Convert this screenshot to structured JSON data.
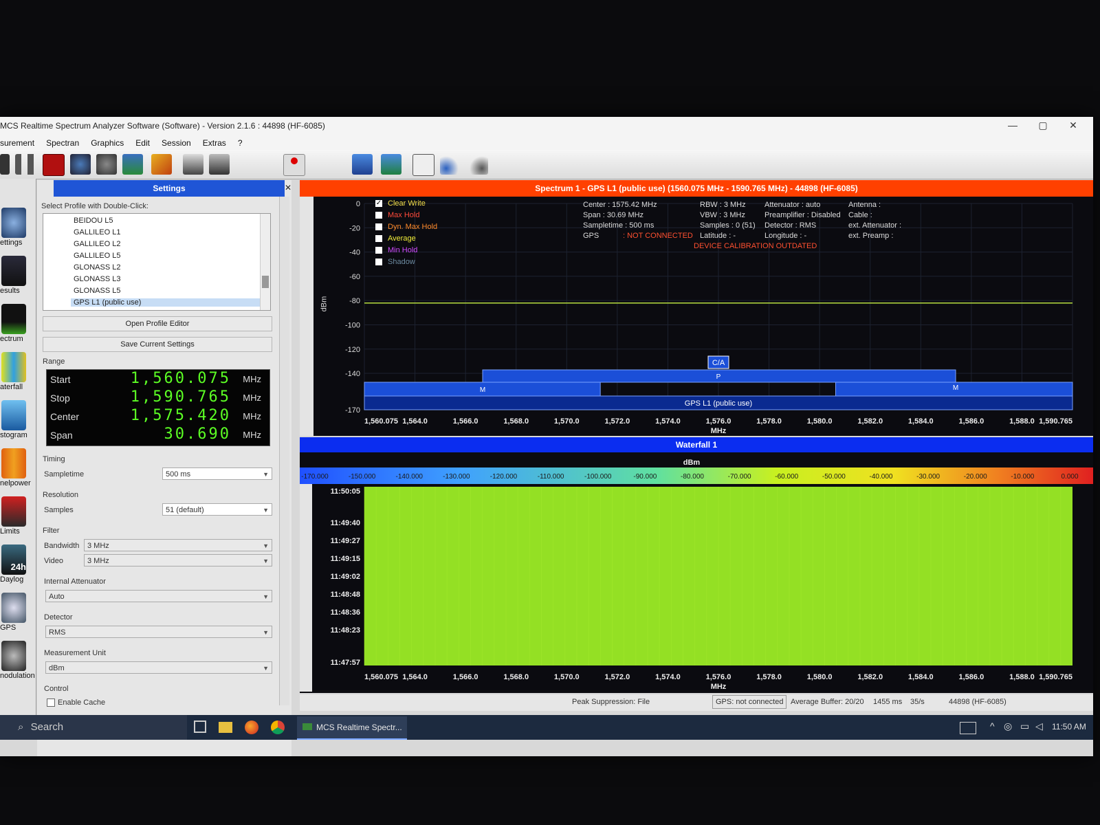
{
  "window": {
    "title": "MCS Realtime Spectrum Analyzer Software (Software) - Version 2.1.6 : 44898 (HF-6085)",
    "minimize": "—",
    "maximize": "▢",
    "close": "✕"
  },
  "menu": [
    "surement",
    "Spectran",
    "Graphics",
    "Edit",
    "Session",
    "Extras",
    "?"
  ],
  "iconbar": [
    "ettings",
    "esults",
    "ectrum",
    "aterfall",
    "stogram",
    "nelpower",
    "Limits",
    "Daylog",
    "GPS",
    "nodulation"
  ],
  "iconbar_overlay": "24h",
  "settings": {
    "header": "Settings",
    "profile_prompt": "Select Profile with Double-Click:",
    "profiles": [
      "BEIDOU L5",
      "GALLILEO L1",
      "GALLILEO L2",
      "GALLILEO L5",
      "GLONASS L2",
      "GLONASS L3",
      "GLONASS L5",
      "GPS L1 (public use)"
    ],
    "open_editor": "Open Profile Editor",
    "save_settings": "Save Current Settings",
    "range_label": "Range",
    "range": [
      {
        "name": "Start",
        "value": "1,560.075",
        "unit": "MHz"
      },
      {
        "name": "Stop",
        "value": "1,590.765",
        "unit": "MHz"
      },
      {
        "name": "Center",
        "value": "1,575.420",
        "unit": "MHz"
      },
      {
        "name": "Span",
        "value": "30.690",
        "unit": "MHz"
      }
    ],
    "timing_label": "Timing",
    "sampletime_label": "Sampletime",
    "sampletime_value": "500 ms",
    "resolution_label": "Resolution",
    "samples_label": "Samples",
    "samples_value": "51 (default)",
    "filter_label": "Filter",
    "bandwidth_label": "Bandwidth",
    "bandwidth_value": "3 MHz",
    "video_label": "Video",
    "video_value": "3 MHz",
    "attenuator_label": "Internal Attenuator",
    "attenuator_value": "Auto",
    "detector_label": "Detector",
    "detector_value": "RMS",
    "unit_label": "Measurement Unit",
    "unit_value": "dBm",
    "control_label": "Control",
    "enable_cache": "Enable Cache"
  },
  "spectrum": {
    "header": "Spectrum 1 - GPS L1 (public use) (1560.075 MHz - 1590.765 MHz) - 44898 (HF-6085)",
    "traces": [
      {
        "name": "Clear Write",
        "checked": true,
        "color": "#f5e04b"
      },
      {
        "name": "Max Hold",
        "checked": false,
        "color": "#ff4a3a"
      },
      {
        "name": "Dyn. Max Hold",
        "checked": false,
        "color": "#ff8a2a"
      },
      {
        "name": "Average",
        "checked": false,
        "color": "#f2ee3a"
      },
      {
        "name": "Min Hold",
        "checked": false,
        "color": "#d04bff"
      },
      {
        "name": "Shadow",
        "checked": false,
        "color": "#6c8aa0"
      }
    ],
    "info": {
      "center": "Center        : 1575.42 MHz",
      "span": "Span          : 30.69 MHz",
      "sampletime": "Sampletime : 500 ms",
      "gps_key": "GPS",
      "gps_val": ": NOT CONNECTED",
      "rbw": "RBW    : 3 MHz",
      "vbw": "VBW    : 3 MHz",
      "samples": "Samples : 0 (51)",
      "latitude": "Latitude : -",
      "att": "Attenuator : auto",
      "preamp": "Preamplifier : Disabled",
      "detector": "Detector    : RMS",
      "longitude": "Longitude   : -",
      "antenna": "Antenna         :",
      "cable": "Cable             :",
      "ext_att": "ext. Attenuator :",
      "ext_pre": "ext. Preamp      :",
      "warning": "DEVICE CALIBRATION OUTDATED"
    },
    "y_unit": "dBm",
    "x_unit": "MHz",
    "y_ticks": [
      "0",
      "-20",
      "-40",
      "-60",
      "-80",
      "-100",
      "-120",
      "-140",
      "-170"
    ],
    "x_ticks": [
      "1,560.075",
      "1,564.0",
      "1,566.0",
      "1,568.0",
      "1,570.0",
      "1,572.0",
      "1,574.0",
      "1,576.0",
      "1,578.0",
      "1,580.0",
      "1,582.0",
      "1,584.0",
      "1,586.0",
      "1,588.0",
      "1,590.765"
    ],
    "bands": {
      "ca": "C/A",
      "p": "P",
      "m1": "M",
      "m2": "M",
      "gps": "GPS L1 (public use)"
    }
  },
  "chart_data": {
    "type": "line",
    "x": [
      1560.075,
      1565,
      1570,
      1575,
      1580,
      1585,
      1590.765
    ],
    "series": [
      {
        "name": "Clear Write",
        "values": [
          -82,
          -82,
          -82,
          -82,
          -82,
          -82,
          -82
        ]
      }
    ],
    "ylabel": "dBm",
    "xlabel": "MHz",
    "xlim": [
      1560.075,
      1590.765
    ],
    "ylim": [
      -170,
      0
    ]
  },
  "waterfall": {
    "header": "Waterfall 1",
    "scale_unit": "dBm",
    "scale": [
      "-170.000",
      "-150.000",
      "-140.000",
      "-130.000",
      "-120.000",
      "-110.000",
      "-100.000",
      "-90.000",
      "-80.000",
      "-70.000",
      "-60.000",
      "-50.000",
      "-40.000",
      "-30.000",
      "-20.000",
      "-10.000",
      "0.000"
    ],
    "times": [
      "11:50:05",
      "11:49:40",
      "11:49:27",
      "11:49:15",
      "11:49:02",
      "11:48:48",
      "11:48:36",
      "11:48:23",
      "11:47:57"
    ],
    "x_unit": "MHz"
  },
  "status": {
    "peak": "Peak Suppression: File",
    "gps": "GPS: not connected",
    "buffer": "Average Buffer: 20/20",
    "ms": "1455 ms",
    "rate": "35/s",
    "device": "44898 (HF-6085)"
  },
  "taskbar": {
    "search": "Search",
    "app": "MCS Realtime Spectr...",
    "clock": "11:50 AM"
  }
}
